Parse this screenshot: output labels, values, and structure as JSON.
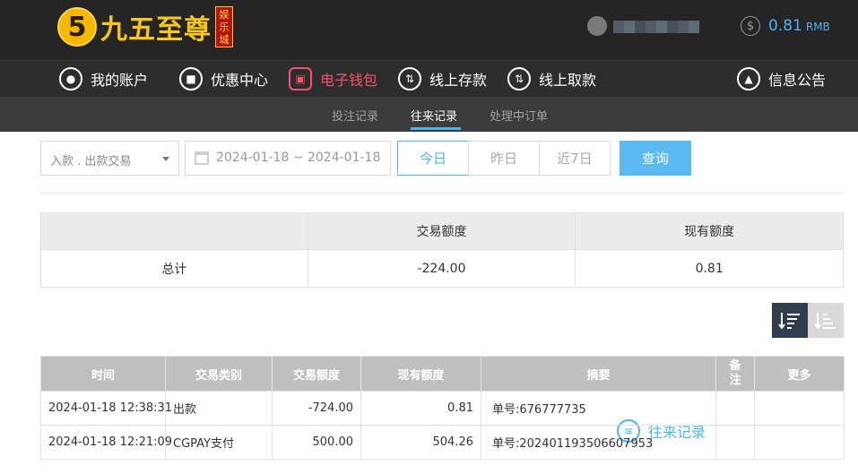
{
  "brand": {
    "logo_mark": "5",
    "name": "九五至尊",
    "tag": "娱乐城"
  },
  "account": {
    "username": "",
    "balance": "0.81",
    "currency": "RMB"
  },
  "main_nav": [
    {
      "label": "我的账户",
      "icon": "user-icon"
    },
    {
      "label": "优惠中心",
      "icon": "gift-icon"
    },
    {
      "label": "电子钱包",
      "icon": "wallet-icon",
      "state": "highlight"
    },
    {
      "label": "线上存款",
      "icon": "deposit-icon"
    },
    {
      "label": "线上取款",
      "icon": "withdraw-icon"
    },
    {
      "label": "往来记录",
      "icon": "records-icon",
      "state": "active"
    },
    {
      "label": "信息公告",
      "icon": "bell-icon"
    }
  ],
  "sub_nav": [
    {
      "label": "投注记录"
    },
    {
      "label": "往来记录",
      "active": true
    },
    {
      "label": "处理中订单"
    }
  ],
  "filters": {
    "type_select": "入款 . 出款交易",
    "date_range": "2024-01-18 ~ 2024-01-18",
    "quick": [
      "今日",
      "昨日",
      "近7日"
    ],
    "query_label": "查询"
  },
  "summary": {
    "headers": [
      "",
      "交易额度",
      "现有额度"
    ],
    "row": [
      "总计",
      "-224.00",
      "0.81"
    ]
  },
  "table": {
    "headers": [
      "时间",
      "交易类别",
      "交易额度",
      "现有额度",
      "摘要",
      "备注",
      "更多"
    ],
    "rows": [
      [
        "2024-01-18 12:38:31",
        "出款",
        "-724.00",
        "0.81",
        "单号:676777735",
        "",
        ""
      ],
      [
        "2024-01-18 12:21:09",
        "CGPAY支付",
        "500.00",
        "504.26",
        "单号:202401193506607953",
        "",
        ""
      ]
    ]
  },
  "colors": {
    "accent": "#4fb4ef",
    "highlight": "#ff4f6b",
    "topbar": "#252525",
    "table_header": "#bfbfbf"
  }
}
